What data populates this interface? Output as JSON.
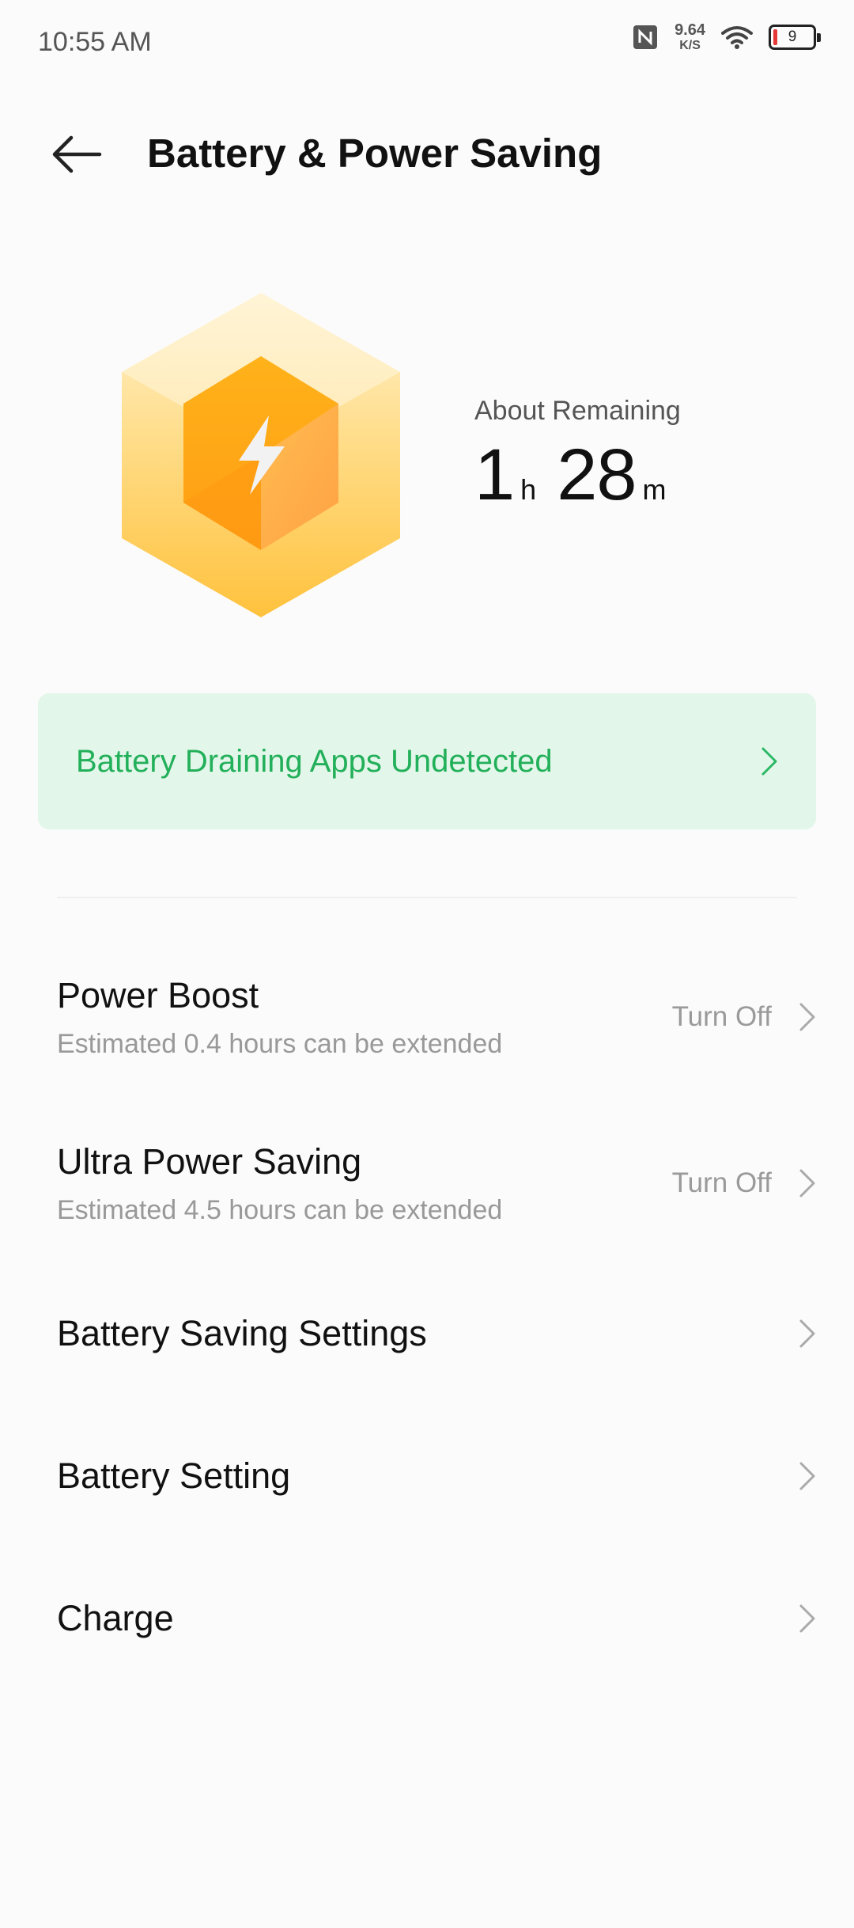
{
  "status_bar": {
    "time": "10:55 AM",
    "net_speed_value": "9.64",
    "net_speed_unit": "K/S",
    "battery_level": "9"
  },
  "header": {
    "title": "Battery & Power Saving"
  },
  "hero": {
    "remaining_label": "About Remaining",
    "hours": "1",
    "hours_unit": "h",
    "minutes": "28",
    "minutes_unit": "m"
  },
  "status_card": {
    "label": "Battery Draining Apps Undetected"
  },
  "list": [
    {
      "title": "Power Boost",
      "subtitle": "Estimated 0.4 hours can be extended",
      "action": "Turn Off"
    },
    {
      "title": "Ultra Power Saving",
      "subtitle": "Estimated 4.5 hours can be extended",
      "action": "Turn Off"
    },
    {
      "title": "Battery Saving Settings"
    },
    {
      "title": "Battery Setting"
    },
    {
      "title": "Charge"
    }
  ],
  "colors": {
    "accent_green": "#23b05a",
    "card_bg": "#e3f6ea",
    "battery_low": "#e53935",
    "hero_orange": "#ffa31a"
  },
  "icons": {
    "back": "arrow-left-icon",
    "chevron": "chevron-right-icon",
    "hero": "battery-hexagon-bolt-icon"
  }
}
